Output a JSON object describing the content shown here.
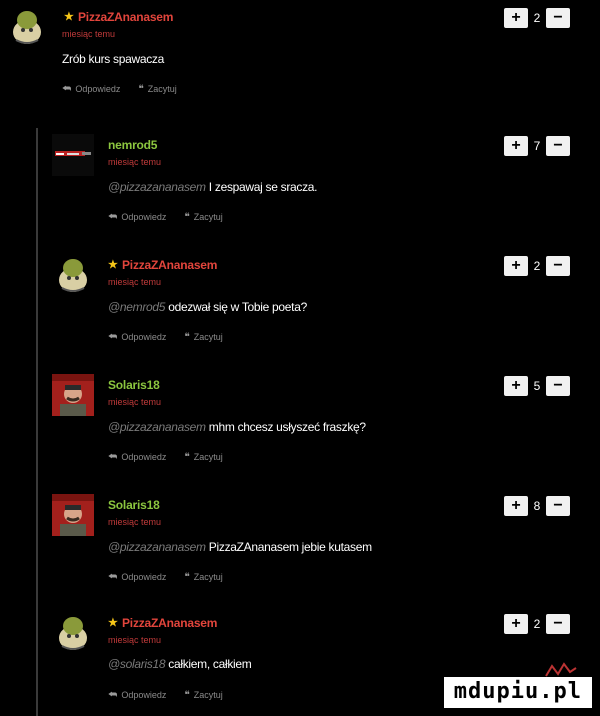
{
  "colors": {
    "username_red": "#e2453c",
    "username_green": "#8cc63f",
    "time": "#c03a3a",
    "star": "#f5c518"
  },
  "comments": [
    {
      "author": "PizzaZAnanasem",
      "star": "★",
      "time": "miesiąc temu",
      "mention": "",
      "text": "Zrób kurs spawacza",
      "votes": "2",
      "reply": "Odpowiedz",
      "quote": "Zacytuj",
      "plus": "+",
      "minus": "−"
    },
    {
      "author": "nemrod5",
      "star": "",
      "time": "miesiąc temu",
      "mention": "@pizzazananasem",
      "text": "I zespawaj se sracza.",
      "votes": "7",
      "reply": "Odpowiedz",
      "quote": "Zacytuj",
      "plus": "+",
      "minus": "−"
    },
    {
      "author": "PizzaZAnanasem",
      "star": "★",
      "time": "miesiąc temu",
      "mention": "@nemrod5",
      "text": "odezwał się w Tobie poeta?",
      "votes": "2",
      "reply": "Odpowiedz",
      "quote": "Zacytuj",
      "plus": "+",
      "minus": "−"
    },
    {
      "author": "Solaris18",
      "star": "",
      "time": "miesiąc temu",
      "mention": "@pizzazananasem",
      "text": "mhm chcesz usłyszeć fraszkę?",
      "votes": "5",
      "reply": "Odpowiedz",
      "quote": "Zacytuj",
      "plus": "+",
      "minus": "−"
    },
    {
      "author": "Solaris18",
      "star": "",
      "time": "miesiąc temu",
      "mention": "@pizzazananasem",
      "text": "PizzaZAnanasem jebie kutasem",
      "votes": "8",
      "reply": "Odpowiedz",
      "quote": "Zacytuj",
      "plus": "+",
      "minus": "−"
    },
    {
      "author": "PizzaZAnanasem",
      "star": "★",
      "time": "miesiąc temu",
      "mention": "@solaris18",
      "text": "całkiem, całkiem",
      "votes": "2",
      "reply": "Odpowiedz",
      "quote": "Zacytuj",
      "plus": "+",
      "minus": "−"
    }
  ],
  "watermark": {
    "text": "mdupiu.pl"
  }
}
